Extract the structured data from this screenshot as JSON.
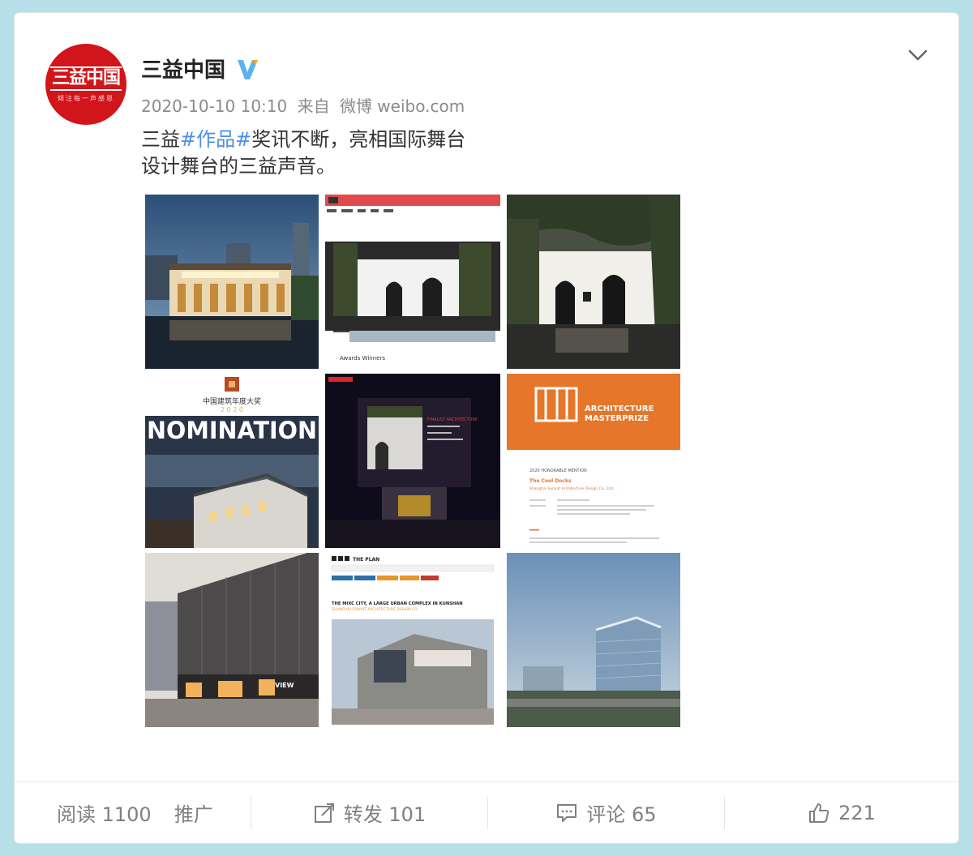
{
  "user": {
    "name": "三益中国",
    "avatar_text": "三益中国",
    "avatar_slogan": "倾注每一声感恩"
  },
  "post": {
    "date": "2020-10-10 10:10",
    "source_prefix": "来自",
    "source": "微博 weibo.com",
    "text_prefix": "三益",
    "hashtag": "#作品#",
    "text_line1_rest": "奖讯不断，亮相国际舞台",
    "text_line2": "设计舞台的三益声音。"
  },
  "images": {
    "award_site_title": "Awards Winners",
    "nomination_title": "中国建筑年度大奖",
    "nomination_year": "2 0 2 0",
    "nomination_word": "NOMINATION",
    "stage_header": "FINALIST ARCHITECTURE",
    "masterprize_line1": "ARCHITECTURE",
    "masterprize_line2": "MASTERPRIZE",
    "masterprize_mention": "2020 HONORABLE MENTION",
    "masterprize_project": "The Cool Docks",
    "masterprize_firm": "Shanghai Sunyat Architecture Design Co., Ltd.",
    "plan_brand": "THE PLAN",
    "plan_headline": "THE MIXC CITY, A LARGE URBAN COMPLEX IN KUNSHAN",
    "plan_firm": "SHANGHAI SUNYAT ARCHITECTURE DESIGN CO.",
    "mall_sign": "VIEW"
  },
  "footer": {
    "reads_label": "阅读 1100",
    "promote_label": "推广",
    "repost_label": "转发 101",
    "comment_label": "评论 65",
    "like_count": "221"
  },
  "colors": {
    "hashtag": "#4c8ee5",
    "verified": "#5ab2f0",
    "brand_red": "#d2151b",
    "masterprize_orange": "#e5762a"
  }
}
